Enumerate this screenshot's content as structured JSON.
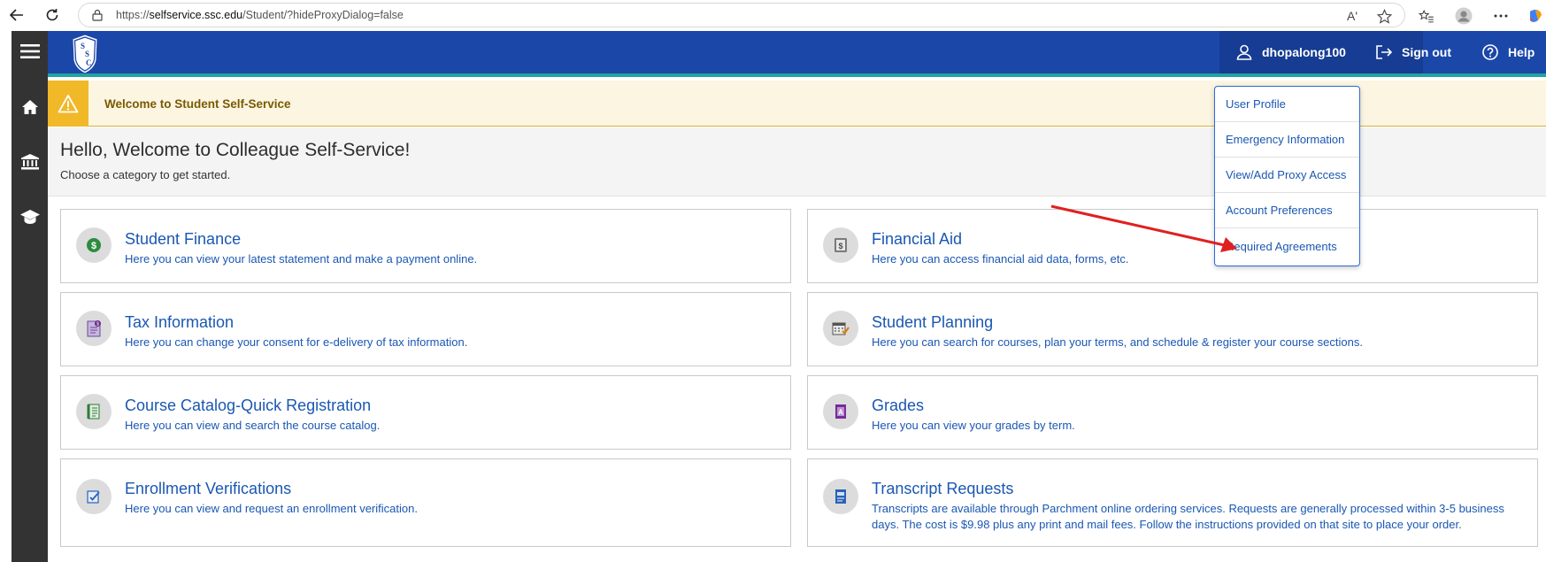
{
  "browser": {
    "url_prefix": "https://",
    "url_host": "selfservice.ssc.edu",
    "url_path": "/Student/?hideProxyDialog=false",
    "read_aloud_label": "Aʹ"
  },
  "header": {
    "logo_text": "SSC",
    "username": "dhopalong100",
    "sign_out_label": "Sign out",
    "help_label": "Help"
  },
  "banner": {
    "text": "Welcome to Student Self-Service"
  },
  "hello": {
    "title": "Hello, Welcome to Colleague Self-Service!",
    "subtitle": "Choose a category to get started."
  },
  "cards": [
    {
      "title": "Student Finance",
      "desc": "Here you can view your latest statement and make a payment online.",
      "icon": "dollar-coin-icon"
    },
    {
      "title": "Financial Aid",
      "desc": "Here you can access financial aid data, forms, etc.",
      "icon": "money-bill-icon"
    },
    {
      "title": "Tax Information",
      "desc": "Here you can change your consent for e-delivery of tax information.",
      "icon": "tax-document-icon"
    },
    {
      "title": "Student Planning",
      "desc": "Here you can search for courses, plan your terms, and schedule & register your course sections.",
      "icon": "calendar-check-icon"
    },
    {
      "title": "Course Catalog-Quick Registration",
      "desc": "Here you can view and search the course catalog.",
      "icon": "catalog-book-icon"
    },
    {
      "title": "Grades",
      "desc": "Here you can view your grades by term.",
      "icon": "grade-a-icon"
    },
    {
      "title": "Enrollment Verifications",
      "desc": "Here you can view and request an enrollment verification.",
      "icon": "verification-form-icon"
    },
    {
      "title": "Transcript Requests",
      "desc": "Transcripts are available through Parchment online ordering services. Requests are generally processed within 3-5 business days. The cost is $9.98 plus any print and mail fees. Follow the instructions provided on that site to place your order.",
      "icon": "transcript-icon"
    }
  ],
  "user_menu": {
    "items": [
      "User Profile",
      "Emergency Information",
      "View/Add Proxy Access",
      "Account Preferences",
      "Required Agreements"
    ]
  },
  "colors": {
    "header_blue": "#1b47a9",
    "rail_dark": "#333333",
    "link_blue": "#1a57b3",
    "banner_yellow": "#f1b828",
    "annotation_red": "#e02020"
  }
}
